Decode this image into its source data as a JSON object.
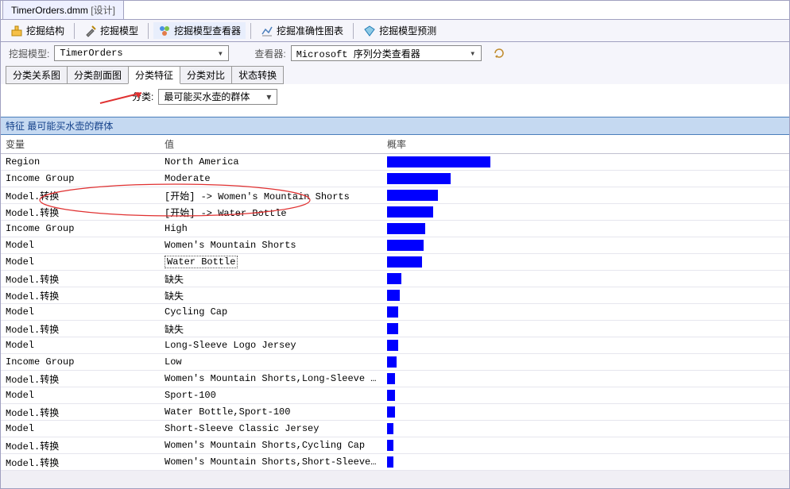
{
  "docTab": {
    "title": "TimerOrders.dmm",
    "suffix": "[设计]"
  },
  "toolbar": {
    "structure": "挖掘结构",
    "model": "挖掘模型",
    "viewer": "挖掘模型查看器",
    "accuracy": "挖掘准确性图表",
    "predict": "挖掘模型预测"
  },
  "params": {
    "modelLabel": "挖掘模型:",
    "modelValue": "TimerOrders",
    "viewerLabel": "查看器:",
    "viewerValue": "Microsoft 序列分类查看器"
  },
  "subTabs": {
    "t1": "分类关系图",
    "t2": "分类剖面图",
    "t3": "分类特征",
    "t4": "分类对比",
    "t5": "状态转换"
  },
  "filter": {
    "label": "分类:",
    "value": "最可能买水壶的群体"
  },
  "section": {
    "title": "特征 最可能买水壶的群体"
  },
  "columns": {
    "var": "变量",
    "val": "值",
    "prob": "概率"
  },
  "rows": [
    {
      "var": "Region",
      "val": "North America",
      "bar": 130
    },
    {
      "var": "Income Group",
      "val": "Moderate",
      "bar": 80
    },
    {
      "var": "Model.转换",
      "val": "[开始] -> Women's Mountain Shorts",
      "bar": 64
    },
    {
      "var": "Model.转换",
      "val": "[开始] -> Water Bottle",
      "bar": 58
    },
    {
      "var": "Income Group",
      "val": "High",
      "bar": 48
    },
    {
      "var": "Model",
      "val": "Women's Mountain Shorts",
      "bar": 46
    },
    {
      "var": "Model",
      "val": "Water Bottle",
      "bar": 44,
      "boxed": true
    },
    {
      "var": "Model.转换",
      "val": "缺失",
      "bar": 18
    },
    {
      "var": "Model.转换",
      "val": "缺失",
      "bar": 16
    },
    {
      "var": "Model",
      "val": "Cycling Cap",
      "bar": 14
    },
    {
      "var": "Model.转换",
      "val": "缺失",
      "bar": 14
    },
    {
      "var": "Model",
      "val": "Long-Sleeve Logo Jersey",
      "bar": 14
    },
    {
      "var": "Income Group",
      "val": "Low",
      "bar": 12
    },
    {
      "var": "Model.转换",
      "val": "Women's Mountain Shorts,Long-Sleeve Lo...",
      "bar": 10
    },
    {
      "var": "Model",
      "val": "Sport-100",
      "bar": 10
    },
    {
      "var": "Model.转换",
      "val": "Water Bottle,Sport-100",
      "bar": 10
    },
    {
      "var": "Model",
      "val": "Short-Sleeve Classic Jersey",
      "bar": 8
    },
    {
      "var": "Model.转换",
      "val": "Women's Mountain Shorts,Cycling Cap",
      "bar": 8
    },
    {
      "var": "Model.转换",
      "val": "Women's Mountain Shorts,Short-Sleeve C...",
      "bar": 8
    }
  ]
}
